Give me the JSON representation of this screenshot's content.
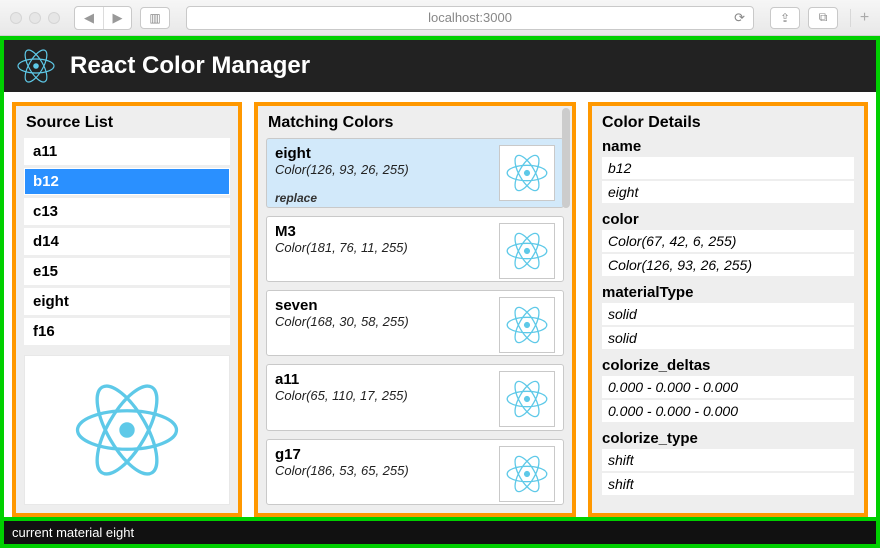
{
  "browser": {
    "url": "localhost:3000"
  },
  "header": {
    "title": "React Color Manager"
  },
  "source": {
    "title": "Source List",
    "items": [
      {
        "label": "a11",
        "selected": false
      },
      {
        "label": "b12",
        "selected": true
      },
      {
        "label": "c13",
        "selected": false
      },
      {
        "label": "d14",
        "selected": false
      },
      {
        "label": "e15",
        "selected": false
      },
      {
        "label": "eight",
        "selected": false
      },
      {
        "label": "f16",
        "selected": false
      }
    ]
  },
  "matching": {
    "title": "Matching Colors",
    "replace_label": "replace",
    "items": [
      {
        "name": "eight",
        "color": "Color(126, 93, 26, 255)",
        "selected": true
      },
      {
        "name": "M3",
        "color": "Color(181, 76, 11, 255)",
        "selected": false
      },
      {
        "name": "seven",
        "color": "Color(168, 30, 58, 255)",
        "selected": false
      },
      {
        "name": "a11",
        "color": "Color(65, 110, 17, 255)",
        "selected": false
      },
      {
        "name": "g17",
        "color": "Color(186, 53, 65, 255)",
        "selected": false
      }
    ]
  },
  "details": {
    "title": "Color Details",
    "fields": [
      {
        "label": "name",
        "rows": [
          "b12",
          "eight"
        ]
      },
      {
        "label": "color",
        "rows": [
          "Color(67, 42, 6, 255)",
          "Color(126, 93, 26, 255)"
        ]
      },
      {
        "label": "materialType",
        "rows": [
          "solid",
          "solid"
        ]
      },
      {
        "label": "colorize_deltas",
        "rows": [
          "0.000 - 0.000 - 0.000",
          "0.000 - 0.000 - 0.000"
        ]
      },
      {
        "label": "colorize_type",
        "rows": [
          "shift",
          "shift"
        ]
      }
    ]
  },
  "footer": {
    "text": "current material eight"
  }
}
